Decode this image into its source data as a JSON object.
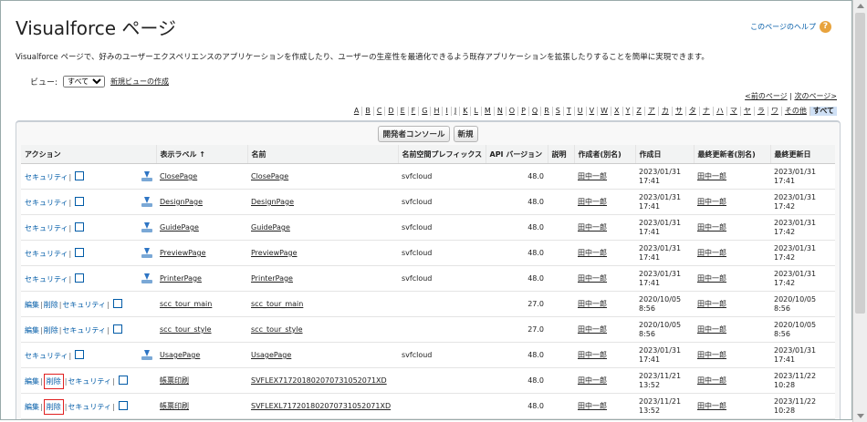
{
  "title": "Visualforce ページ",
  "help_link": "このページのヘルプ",
  "description": "Visualforce ページで、好みのユーザーエクスペリエンスのアプリケーションを作成したり、ユーザーの生産性を最適化できるよう既存アプリケーションを拡張したりすることを簡単に実現できます。",
  "view": {
    "label": "ビュー:",
    "selected": "すべて",
    "new_view_link": "新規ビューの作成"
  },
  "pager": {
    "prev": "<前のページ",
    "next": "次のページ>"
  },
  "alpha_filter": [
    "A",
    "B",
    "C",
    "D",
    "E",
    "F",
    "G",
    "H",
    "I",
    "J",
    "K",
    "L",
    "M",
    "N",
    "O",
    "P",
    "Q",
    "R",
    "S",
    "T",
    "U",
    "V",
    "W",
    "X",
    "Y",
    "Z",
    "ア",
    "カ",
    "サ",
    "タ",
    "ナ",
    "ハ",
    "マ",
    "ヤ",
    "ラ",
    "ワ",
    "その他",
    "すべて"
  ],
  "alpha_selected": "すべて",
  "buttons": {
    "dev_console": "開発者コンソール",
    "new": "新規"
  },
  "columns": [
    "アクション",
    "表示ラベル ↑",
    "名前",
    "名前空間プレフィックス",
    "API バージョン",
    "説明",
    "作成者(別名)",
    "作成日",
    "最終更新者(別名)",
    "最終更新日"
  ],
  "action_labels": {
    "edit": "編集",
    "delete": "削除",
    "security": "セキュリティ"
  },
  "rows": [
    {
      "edit": false,
      "download": true,
      "highlight": false,
      "label": "ClosePage",
      "name": "ClosePage",
      "ns": "svfcloud",
      "api": "48.0",
      "desc": "",
      "creator": "田中一郎",
      "created_date": "2023/01/31",
      "created_time": "17:41",
      "modifier": "田中一郎",
      "modified_date": "2023/01/31",
      "modified_time": "17:41"
    },
    {
      "edit": false,
      "download": true,
      "highlight": false,
      "label": "DesignPage",
      "name": "DesignPage",
      "ns": "svfcloud",
      "api": "48.0",
      "desc": "",
      "creator": "田中一郎",
      "created_date": "2023/01/31",
      "created_time": "17:41",
      "modifier": "田中一郎",
      "modified_date": "2023/01/31",
      "modified_time": "17:42"
    },
    {
      "edit": false,
      "download": true,
      "highlight": false,
      "label": "GuidePage",
      "name": "GuidePage",
      "ns": "svfcloud",
      "api": "48.0",
      "desc": "",
      "creator": "田中一郎",
      "created_date": "2023/01/31",
      "created_time": "17:41",
      "modifier": "田中一郎",
      "modified_date": "2023/01/31",
      "modified_time": "17:42"
    },
    {
      "edit": false,
      "download": true,
      "highlight": false,
      "label": "PreviewPage",
      "name": "PreviewPage",
      "ns": "svfcloud",
      "api": "48.0",
      "desc": "",
      "creator": "田中一郎",
      "created_date": "2023/01/31",
      "created_time": "17:41",
      "modifier": "田中一郎",
      "modified_date": "2023/01/31",
      "modified_time": "17:42"
    },
    {
      "edit": false,
      "download": true,
      "highlight": false,
      "label": "PrinterPage",
      "name": "PrinterPage",
      "ns": "svfcloud",
      "api": "48.0",
      "desc": "",
      "creator": "田中一郎",
      "created_date": "2023/01/31",
      "created_time": "17:41",
      "modifier": "田中一郎",
      "modified_date": "2023/01/31",
      "modified_time": "17:42"
    },
    {
      "edit": true,
      "download": false,
      "highlight": false,
      "label": "scc_tour_main",
      "name": "scc_tour_main",
      "ns": "",
      "api": "27.0",
      "desc": "",
      "creator": "田中一郎",
      "created_date": "2020/10/05",
      "created_time": "8:56",
      "modifier": "田中一郎",
      "modified_date": "2020/10/05",
      "modified_time": "8:56"
    },
    {
      "edit": true,
      "download": false,
      "highlight": false,
      "label": "scc_tour_style",
      "name": "scc_tour_style",
      "ns": "",
      "api": "27.0",
      "desc": "",
      "creator": "田中一郎",
      "created_date": "2020/10/05",
      "created_time": "8:56",
      "modifier": "田中一郎",
      "modified_date": "2020/10/05",
      "modified_time": "8:56"
    },
    {
      "edit": false,
      "download": true,
      "highlight": false,
      "label": "UsagePage",
      "name": "UsagePage",
      "ns": "svfcloud",
      "api": "48.0",
      "desc": "",
      "creator": "田中一郎",
      "created_date": "2023/01/31",
      "created_time": "17:41",
      "modifier": "田中一郎",
      "modified_date": "2023/01/31",
      "modified_time": "17:41"
    },
    {
      "edit": true,
      "download": false,
      "highlight": true,
      "label": "帳票印刷",
      "name": "SVFLEX717201802070731052071XD",
      "ns": "",
      "api": "48.0",
      "desc": "",
      "creator": "田中一郎",
      "created_date": "2023/11/21",
      "created_time": "13:52",
      "modifier": "田中一郎",
      "modified_date": "2023/11/22",
      "modified_time": "10:28"
    },
    {
      "edit": true,
      "download": false,
      "highlight": true,
      "label": "帳票印刷",
      "name": "SVFLEXL717201802070731052071XD",
      "ns": "",
      "api": "48.0",
      "desc": "",
      "creator": "田中一郎",
      "created_date": "2023/11/21",
      "created_time": "13:52",
      "modifier": "田中一郎",
      "modified_date": "2023/11/22",
      "modified_time": "10:28"
    }
  ]
}
